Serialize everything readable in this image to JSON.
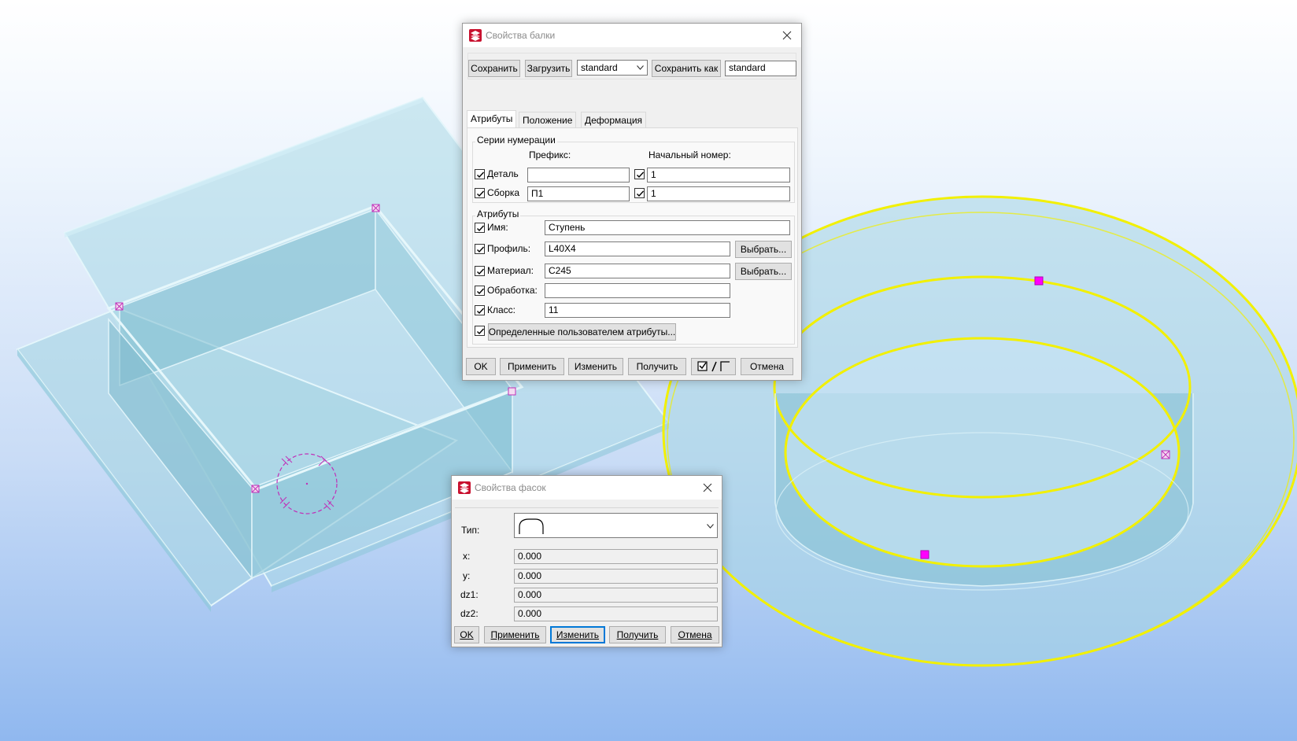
{
  "colors": {
    "model_face": "#a9d9e8",
    "model_edge": "#d9f1f8",
    "selection": "#f2f000",
    "handle": "#e020d0"
  },
  "beam_dialog": {
    "title": "Свойства балки",
    "toolbar": {
      "save_label": "Сохранить",
      "load_label": "Загрузить",
      "preset_value": "standard",
      "save_as_label": "Сохранить как",
      "save_as_value": "standard"
    },
    "tabs": [
      "Атрибуты",
      "Положение",
      "Деформация"
    ],
    "numbering": {
      "title": "Серии нумерации",
      "prefix_header": "Префикс:",
      "start_header": "Начальный номер:",
      "rows": [
        {
          "label": "Деталь",
          "prefix": "",
          "start": "1"
        },
        {
          "label": "Сборка",
          "prefix": "П1",
          "start": "1"
        }
      ]
    },
    "attributes": {
      "title": "Атрибуты",
      "name_label": "Имя:",
      "name_value": "Ступень",
      "profile_label": "Профиль:",
      "profile_value": "L40X4",
      "material_label": "Материал:",
      "material_value": "C245",
      "finish_label": "Обработка:",
      "finish_value": "",
      "class_label": "Класс:",
      "class_value": "11",
      "select_label": "Выбрать...",
      "user_attrs_label": "Определенные пользователем атрибуты..."
    },
    "footer": {
      "ok": "OK",
      "apply": "Применить",
      "modify": "Изменить",
      "get": "Получить",
      "cancel": "Отмена"
    }
  },
  "chamfer_dialog": {
    "title": "Свойства фасок",
    "type_label": "Тип:",
    "fields": [
      {
        "label": "x:",
        "value": "0.000"
      },
      {
        "label": "y:",
        "value": "0.000"
      },
      {
        "label": "dz1:",
        "value": "0.000"
      },
      {
        "label": "dz2:",
        "value": "0.000"
      }
    ],
    "footer": {
      "ok": "OK",
      "apply": "Применить",
      "modify": "Изменить",
      "get": "Получить",
      "cancel": "Отмена"
    }
  }
}
